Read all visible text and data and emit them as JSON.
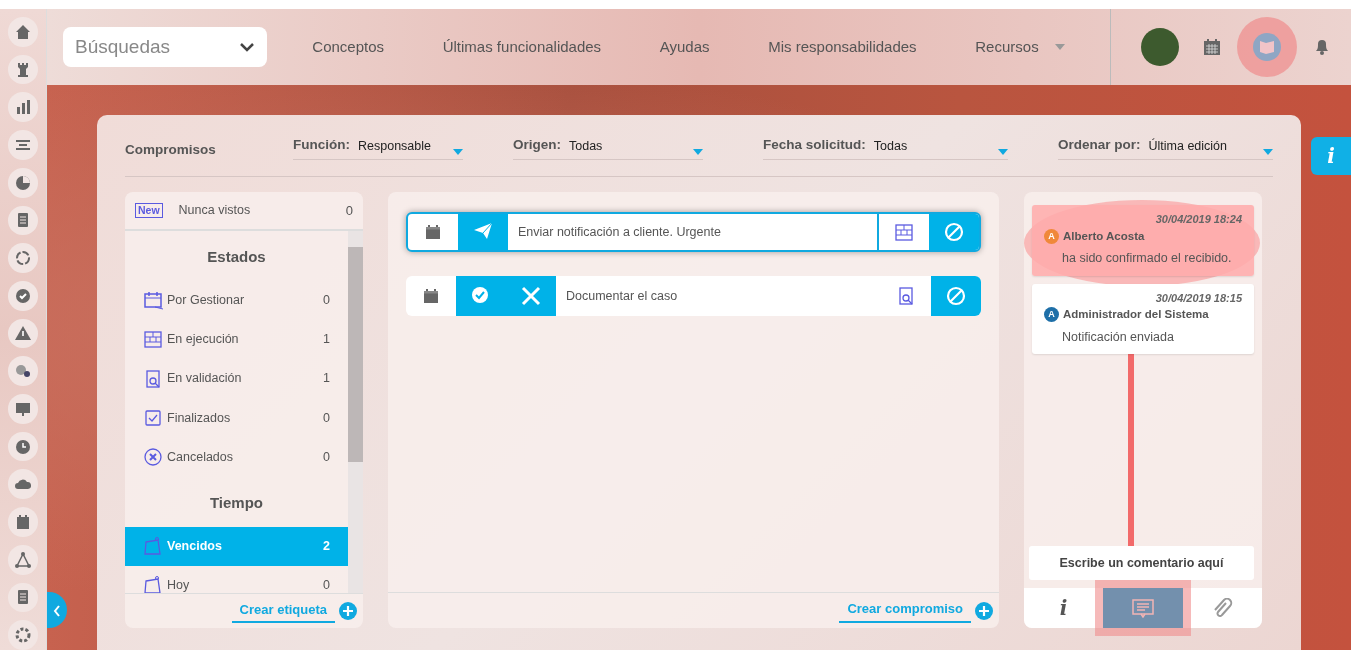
{
  "topbar": {
    "search": {
      "value": "Búsquedas"
    },
    "links": [
      {
        "label": "Conceptos",
        "dropdown": false
      },
      {
        "label": "Últimas funcionalidades",
        "dropdown": false
      },
      {
        "label": "Ayudas",
        "dropdown": false
      },
      {
        "label": "Mis responsabilidades",
        "dropdown": false
      },
      {
        "label": "Recursos",
        "dropdown": true
      }
    ],
    "tools": [
      {
        "kind": "avatar",
        "highlighted": false
      },
      {
        "kind": "calendar",
        "highlighted": false
      },
      {
        "kind": "notes",
        "highlighted": true
      },
      {
        "kind": "bell",
        "highlighted": false
      }
    ]
  },
  "filters": {
    "title": "Compromisos",
    "fields": [
      {
        "label": "Función:",
        "value": "Responsable"
      },
      {
        "label": "Origen:",
        "value": "Todas"
      },
      {
        "label": "Fecha solicitud:",
        "value": "Todas"
      },
      {
        "label": "Ordenar por:",
        "value": "Última edición"
      }
    ]
  },
  "sidebar": {
    "top": {
      "badge": "New",
      "label": "Nunca vistos",
      "count": "0"
    },
    "sections": [
      {
        "title": "Estados",
        "items": [
          {
            "kind": "pending",
            "label": "Por Gestionar",
            "count": "0",
            "selected": false
          },
          {
            "kind": "running",
            "label": "En ejecución",
            "count": "1",
            "selected": false
          },
          {
            "kind": "review",
            "label": "En validación",
            "count": "1",
            "selected": false
          },
          {
            "kind": "done",
            "label": "Finalizados",
            "count": "0",
            "selected": false
          },
          {
            "kind": "cancelled",
            "label": "Cancelados",
            "count": "0",
            "selected": false
          }
        ]
      },
      {
        "title": "Tiempo",
        "items": [
          {
            "kind": "note",
            "label": "Vencidos",
            "count": "2",
            "selected": true
          },
          {
            "kind": "note",
            "label": "Hoy",
            "count": "0",
            "selected": false
          }
        ]
      }
    ],
    "create": "Crear etiqueta"
  },
  "tasks": [
    {
      "text": "Enviar notificación a cliente. Urgente",
      "selected": true,
      "actions": [
        {
          "kind": "send"
        }
      ],
      "status": {
        "kind": "running"
      }
    },
    {
      "text": "Documentar el caso",
      "selected": false,
      "actions": [
        {
          "kind": "approve"
        },
        {
          "kind": "reject"
        }
      ],
      "status": {
        "kind": "review"
      }
    }
  ],
  "create_task": "Crear compromiso",
  "comments": [
    {
      "date": "30/04/2019 18:24",
      "initial": "A",
      "color": "#f0883a",
      "author": "Alberto Acosta",
      "text": "ha sido confirmado el recibido.",
      "highlighted": true
    },
    {
      "date": "30/04/2019 18:15",
      "initial": "A",
      "color": "#1e6fa8",
      "author": "Administrador del Sistema",
      "text": "Notificación enviada",
      "highlighted": false
    }
  ],
  "comment_box": {
    "placeholder": "Escribe un comentario aquí"
  },
  "panel_tabs": [
    {
      "kind": "info",
      "label": "i",
      "selected": false
    },
    {
      "kind": "comments",
      "selected": true
    },
    {
      "kind": "attachments",
      "selected": false
    }
  ],
  "info_tab": {
    "label": "i"
  }
}
